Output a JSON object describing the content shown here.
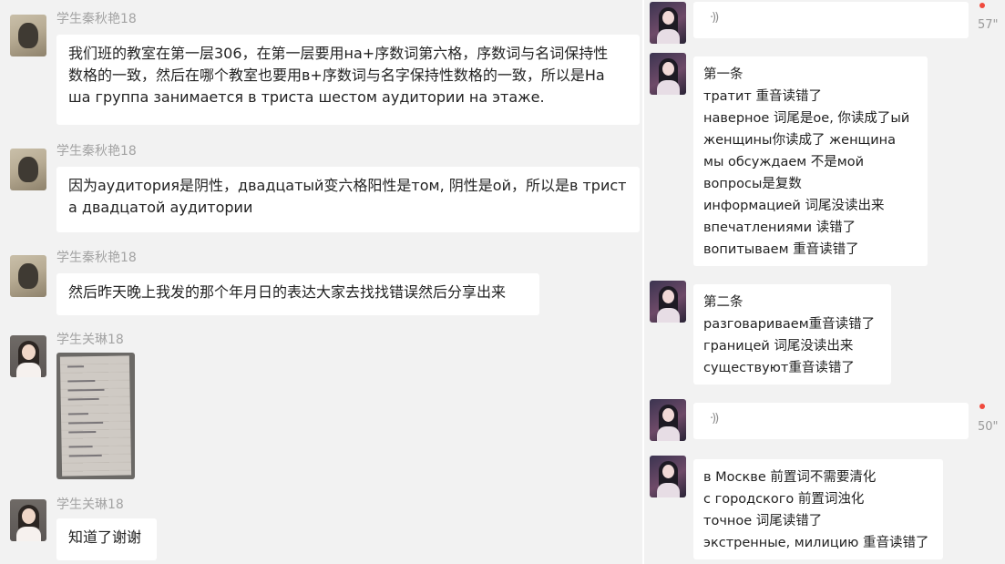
{
  "left": {
    "messages": [
      {
        "sender": "学生秦秋艳18",
        "lines": [
          "我们班的教室在第一层306，在第一层要用на+序数词第六格，序数词与名词保持性",
          "数格的一致，然后在哪个教室也要用в+序数词与名字保持性数格的一致，所以是На",
          "ша группа занимается в триста шестом аудитории на этаже."
        ]
      },
      {
        "sender": "学生秦秋艳18",
        "lines": [
          "因为аудитория是阴性，двадцатый变六格阳性是том, 阴性是ой，所以是в трист",
          "а  двадцатой аудитории"
        ]
      },
      {
        "sender": "学生秦秋艳18",
        "lines": [
          "然后昨天晚上我发的那个年月日的表达大家去找找错误然后分享出来"
        ]
      },
      {
        "sender": "学生关琳18"
      },
      {
        "sender": "学生关琳18",
        "lines": [
          "知道了谢谢"
        ]
      }
    ]
  },
  "right": {
    "voice1": {
      "wave": "·))",
      "duration": "57\""
    },
    "note1": [
      "第一条",
      "тратит 重音读错了",
      "наверное 词尾是ое, 你读成了ый",
      "женщины你读成了 женщина",
      "мы обсуждаем 不是мой",
      "вопросы是复数",
      "информацией 词尾没读出来",
      "впечатлениями 读错了",
      "вопитываем 重音读错了"
    ],
    "note2": [
      "第二条",
      "разговариваем重音读错了",
      "границей 词尾没读出来",
      "существуют重音读错了"
    ],
    "voice2": {
      "wave": "·))",
      "duration": "50\""
    },
    "note3": [
      "в Москве 前置词不需要清化",
      "с городского 前置词浊化",
      "точное 词尾读错了",
      "экстренные, милицию 重音读错了"
    ]
  }
}
